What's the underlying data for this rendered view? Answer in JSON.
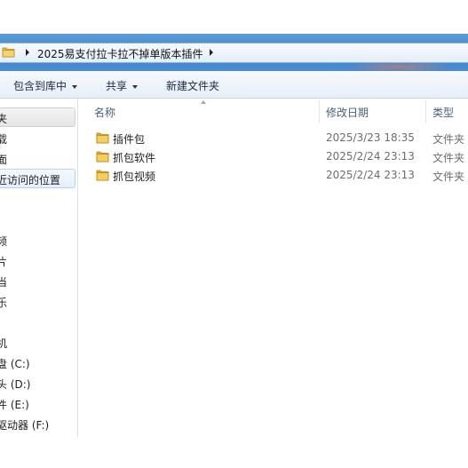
{
  "address_bar": {
    "breadcrumb": "2025易支付拉卡拉不掉单版本插件"
  },
  "toolbar": {
    "include_library": "包含到库中",
    "share": "共享",
    "new_folder": "新建文件夹"
  },
  "nav_pane": {
    "items": [
      "夹",
      "载",
      "面",
      "近访问的位置",
      "",
      "频",
      "片",
      "当",
      "乐",
      "",
      "机",
      "盘 (C:)",
      "头 (D:)",
      "件 (E:)",
      "驱动器 (F:)"
    ]
  },
  "columns": {
    "name": "名称",
    "modified": "修改日期",
    "type": "类型"
  },
  "files": [
    {
      "name": "插件包",
      "modified": "2025/3/23 18:35",
      "type": "文件夹"
    },
    {
      "name": "抓包软件",
      "modified": "2025/2/24 23:13",
      "type": "文件夹"
    },
    {
      "name": "抓包视频",
      "modified": "2025/2/24 23:13",
      "type": "文件夹"
    }
  ],
  "colors": {
    "address_frame": "#3d82c9",
    "folder_yellow": "#f3c64a",
    "column_header": "#4a5f7f",
    "meta_text": "#6d6d6d"
  }
}
